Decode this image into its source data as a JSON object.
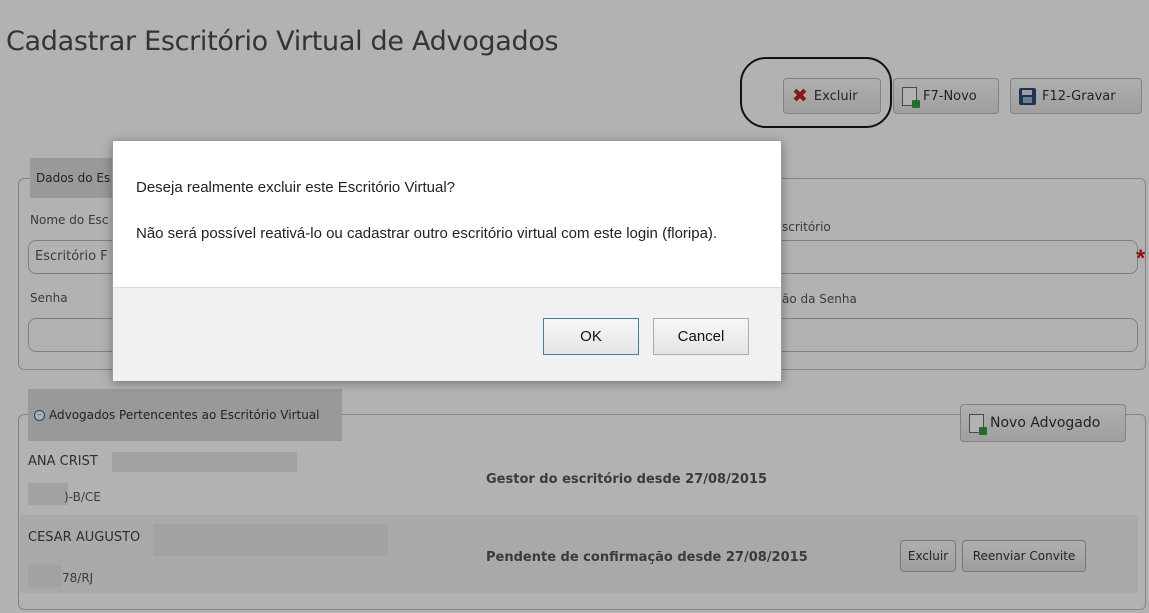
{
  "page": {
    "title": "Cadastrar Escritório Virtual de Advogados"
  },
  "toolbar": {
    "excluir_label": "Excluir",
    "novo_label": "F7-Novo",
    "gravar_label": "F12-Gravar"
  },
  "form": {
    "legend": "Dados do Es",
    "name_label": "Nome do Esc",
    "name_value": "Escritório F",
    "login_label": "scritório",
    "senha_label": "Senha",
    "confirm_label": "ão da Senha",
    "required_mark": "*"
  },
  "advogados": {
    "legend": "Advogados Pertencentes ao Escritório Virtual",
    "novo_label": "Novo Advogado",
    "rows": [
      {
        "name": "ANA CRIST",
        "oab": ")-B/CE",
        "status": "Gestor do escritório desde 27/08/2015"
      },
      {
        "name": "CESAR AUGUSTO",
        "oab": "78/RJ",
        "status": "Pendente de confirmação desde 27/08/2015",
        "excluir_label": "Excluir",
        "reenviar_label": "Reenviar Convite"
      }
    ]
  },
  "dialog": {
    "message_line1": "Deseja realmente excluir este Escritório Virtual?",
    "message_line2": "Não será possível reativá-lo ou cadastrar outro escritório virtual com este login (floripa).",
    "ok_label": "OK",
    "cancel_label": "Cancel"
  },
  "icons": {
    "excluir": "close-x-icon",
    "novo": "new-document-icon",
    "gravar": "floppy-disk-icon",
    "collapse": "collapse-minus-icon"
  },
  "colors": {
    "danger": "#c41f1f",
    "required": "#d21f1f",
    "overlay": "rgba(0,0,0,0.3)"
  }
}
